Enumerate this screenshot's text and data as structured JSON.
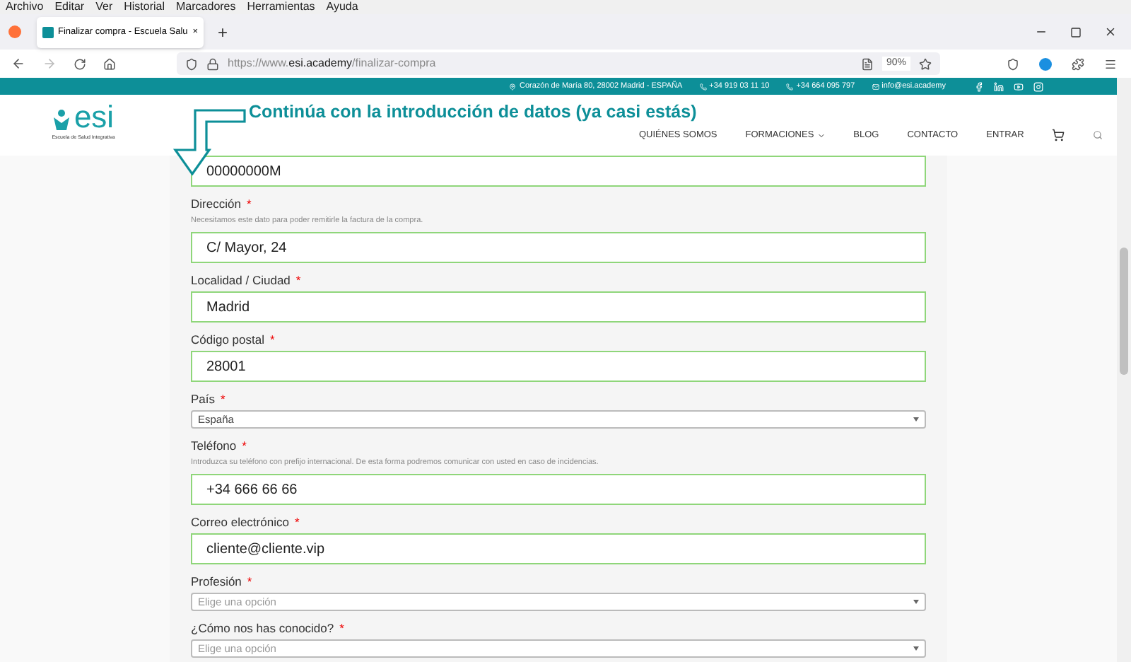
{
  "menu_bar": [
    "Archivo",
    "Editar",
    "Ver",
    "Historial",
    "Marcadores",
    "Herramientas",
    "Ayuda"
  ],
  "tab": {
    "title": "Finalizar compra - Escuela Salu",
    "selected": true,
    "close": "×",
    "new": "+"
  },
  "address_bar": {
    "prefix": "https://www.",
    "domain": "esi.academy",
    "path": "/finalizar-compra",
    "zoom": "90%"
  },
  "top_bar": {
    "address": "Corazón de María 80, 28002 Madrid - ESPAÑA",
    "phone": "+34 919 03 11 10",
    "whatsapp": "+34 664 095 797",
    "email": "info@esi.academy"
  },
  "logo": {
    "name": "esi",
    "subtitle": "Escuela de Salud Integrativa"
  },
  "banner": "Continúa con la introducción de datos (ya casi estás)",
  "nav": [
    {
      "label": "QUIÉNES SOMOS",
      "dropdown": false
    },
    {
      "label": "FORMACIONES",
      "dropdown": true
    },
    {
      "label": "BLOG",
      "dropdown": false
    },
    {
      "label": "CONTACTO",
      "dropdown": false
    },
    {
      "label": "ENTRAR",
      "dropdown": false
    }
  ],
  "fields": [
    {
      "kind": "text",
      "value": "00000000M",
      "valid": true
    },
    {
      "kind": "text",
      "label": "Dirección",
      "marker": "*",
      "hint": "Necesitamos este dato para poder remitirle la factura de la compra.",
      "value": "C/ Mayor, 24",
      "valid": true
    },
    {
      "kind": "text",
      "label": "Localidad / Ciudad",
      "marker": "*",
      "value": "Madrid",
      "valid": true
    },
    {
      "kind": "text",
      "label": "Código postal",
      "marker": "*",
      "value": "28001",
      "valid": true
    },
    {
      "kind": "select",
      "label": "País",
      "marker": "*",
      "value": "España"
    },
    {
      "kind": "text",
      "label": "Teléfono",
      "marker": "*",
      "hint": "Introduzca su teléfono con prefijo internacional. De esta forma podremos comunicar con usted en caso de incidencias.",
      "value": "+34 666 66 66",
      "valid": true
    },
    {
      "kind": "text",
      "label": "Correo electrónico",
      "marker": "*",
      "value": "cliente@cliente.vip",
      "valid": true
    },
    {
      "kind": "select",
      "label": "Profesión",
      "marker": "*",
      "placeholder": "Elige una opción"
    },
    {
      "kind": "select",
      "label": "¿Cómo nos has conocido?",
      "marker": "*",
      "placeholder": "Elige una opción"
    }
  ]
}
